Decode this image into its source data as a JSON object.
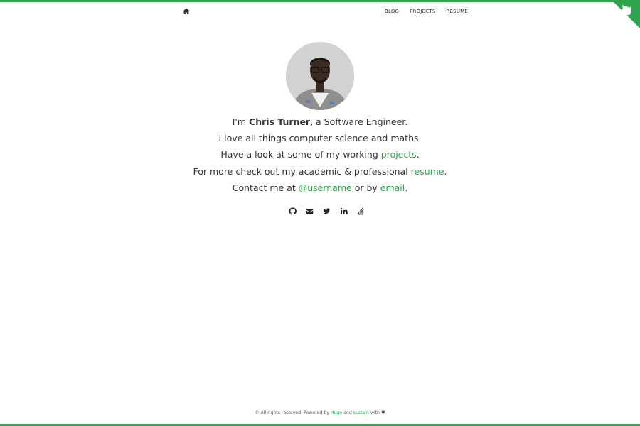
{
  "theme": {
    "accent": "#2ea44f",
    "text": "#333333",
    "background": "#ffffff"
  },
  "nav": {
    "home_icon": "home-icon",
    "items": [
      {
        "label": "BLOG"
      },
      {
        "label": "PROJECTS"
      },
      {
        "label": "RESUME"
      }
    ]
  },
  "corner_icon": "github-corner-octocat-icon",
  "profile": {
    "avatar": "profile-photo",
    "line1_pre": "I'm ",
    "name": "Chris Turner",
    "line1_post": ", a Software Engineer.",
    "line2": "I love all things computer science and maths.",
    "line3_pre": "Have a look at some of my working ",
    "line3_link": "projects",
    "line3_post": ".",
    "line4_pre": "For more check out my academic & professional ",
    "line4_link": "resume",
    "line4_post": ".",
    "line5_pre": "Contact me at ",
    "line5_link1": "@username",
    "line5_mid": " or by ",
    "line5_link2": "email",
    "line5_post": "."
  },
  "socials": [
    {
      "icon": "github-icon"
    },
    {
      "icon": "envelope-icon"
    },
    {
      "icon": "twitter-icon"
    },
    {
      "icon": "linkedin-icon"
    },
    {
      "icon": "stackoverflow-icon"
    }
  ],
  "footer": {
    "pre": "© All rights reserved. Powered by ",
    "link1": "Hugo",
    "mid": " and ",
    "link2": "sustain",
    "post": " with ♥"
  }
}
